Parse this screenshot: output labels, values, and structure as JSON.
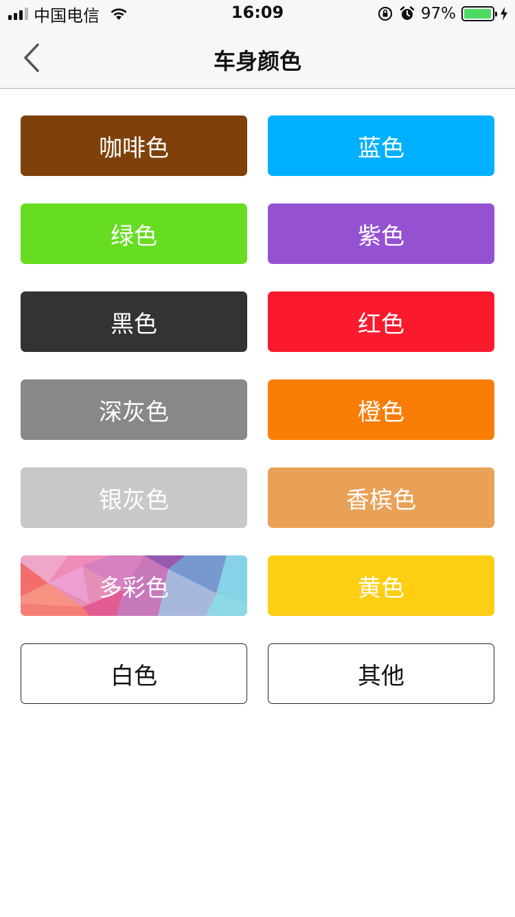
{
  "status_bar": {
    "carrier": "中国电信",
    "time": "16:09",
    "battery_percent": "97%",
    "battery_level": 0.97,
    "icons": [
      "signal-icon",
      "wifi-icon",
      "rotation-lock-icon",
      "alarm-icon",
      "battery-icon",
      "charging-icon"
    ]
  },
  "nav": {
    "title": "车身颜色",
    "back_icon": "chevron-left-icon"
  },
  "colors": [
    {
      "label": "咖啡色",
      "bg": "#7f400a",
      "text": "#ffffff"
    },
    {
      "label": "蓝色",
      "bg": "#00b0ff",
      "text": "#ffffff"
    },
    {
      "label": "绿色",
      "bg": "#66dd22",
      "text": "#ffffff"
    },
    {
      "label": "紫色",
      "bg": "#9452d3",
      "text": "#ffffff"
    },
    {
      "label": "黑色",
      "bg": "#333333",
      "text": "#ffffff"
    },
    {
      "label": "红色",
      "bg": "#fb1a2d",
      "text": "#ffffff"
    },
    {
      "label": "深灰色",
      "bg": "#888888",
      "text": "#ffffff"
    },
    {
      "label": "橙色",
      "bg": "#f97d07",
      "text": "#ffffff"
    },
    {
      "label": "银灰色",
      "bg": "#c9c8c9",
      "text": "#ffffff"
    },
    {
      "label": "香槟色",
      "bg": "#e9a157",
      "text": "#ffffff"
    },
    {
      "label": "多彩色",
      "bg": "multicolor",
      "text": "#ffffff"
    },
    {
      "label": "黄色",
      "bg": "#fece13",
      "text": "#ffffff"
    },
    {
      "label": "白色",
      "bg": "#ffffff",
      "text": "#111111",
      "outlined": true
    },
    {
      "label": "其他",
      "bg": "#ffffff",
      "text": "#111111",
      "outlined": true
    }
  ]
}
